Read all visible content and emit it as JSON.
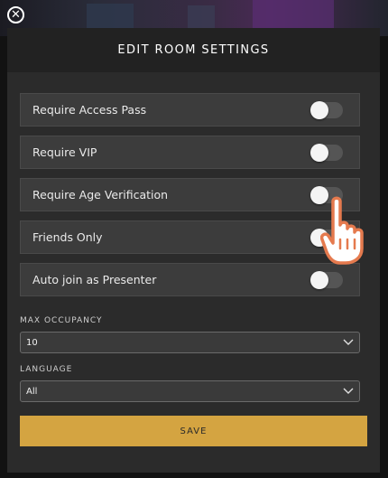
{
  "header": {
    "title": "EDIT ROOM SETTINGS"
  },
  "toggles": [
    {
      "label": "Require Access Pass",
      "on": false
    },
    {
      "label": "Require VIP",
      "on": false
    },
    {
      "label": "Require Age Verification",
      "on": false
    },
    {
      "label": "Friends Only",
      "on": false
    },
    {
      "label": "Auto join as Presenter",
      "on": false
    }
  ],
  "max_occupancy": {
    "label": "MAX OCCUPANCY",
    "value": "10"
  },
  "language": {
    "label": "LANGUAGE",
    "value": "All"
  },
  "save_label": "SAVE",
  "colors": {
    "accent": "#d4a441",
    "panel": "#2b2b2b",
    "row": "#3c3c3c",
    "cursor_outline": "#e57a4e"
  },
  "icons": {
    "close": "close-circle-icon",
    "chevron": "chevron-down-icon",
    "cursor": "hand-pointer-icon"
  }
}
